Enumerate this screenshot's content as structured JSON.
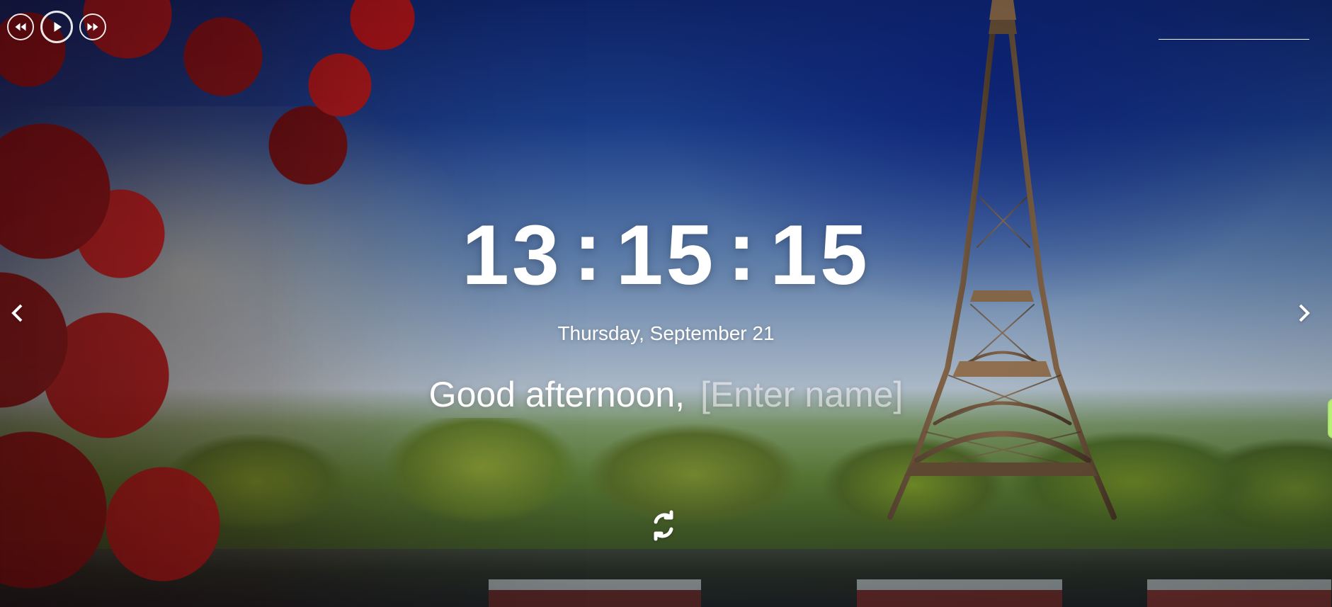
{
  "media_controls": {
    "previous_icon": "rewind-icon",
    "play_icon": "play-icon",
    "next_icon": "fast-forward-icon"
  },
  "clock": {
    "hour": "13",
    "minute": "15",
    "second": "15",
    "separator": ":"
  },
  "date": {
    "text": "Thursday, September 21"
  },
  "greeting": {
    "prefix": "Good afternoon,",
    "name_placeholder": "[Enter name]"
  },
  "navigation": {
    "left_icon": "chevron-left-icon",
    "right_icon": "chevron-right-icon"
  },
  "actions": {
    "refresh_icon": "refresh-icon"
  },
  "colors": {
    "text": "#ffffff",
    "side_tab": "#b8ef78"
  }
}
